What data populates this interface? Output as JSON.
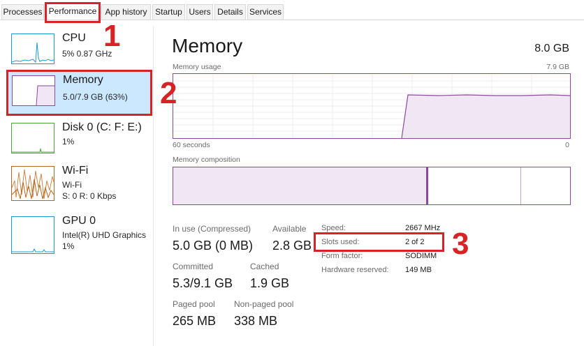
{
  "tabs": [
    {
      "label": "Processes"
    },
    {
      "label": "Performance"
    },
    {
      "label": "App history"
    },
    {
      "label": "Startup"
    },
    {
      "label": "Users"
    },
    {
      "label": "Details"
    },
    {
      "label": "Services"
    }
  ],
  "sidebar": {
    "items": [
      {
        "title": "CPU",
        "subtitle": "5%  0.87 GHz",
        "subtitle2": ""
      },
      {
        "title": "Memory",
        "subtitle": "5.0/7.9 GB (63%)",
        "subtitle2": ""
      },
      {
        "title": "Disk 0 (C: F: E:)",
        "subtitle": "1%",
        "subtitle2": ""
      },
      {
        "title": "Wi-Fi",
        "subtitle": "Wi-Fi",
        "subtitle2": "S: 0  R: 0 Kbps"
      },
      {
        "title": "GPU 0",
        "subtitle": "Intel(R) UHD Graphics",
        "subtitle2": "1%"
      }
    ]
  },
  "main": {
    "title": "Memory",
    "total": "8.0 GB",
    "usage_label": "Memory usage",
    "usage_max": "7.9 GB",
    "time_left": "60 seconds",
    "time_right": "0",
    "composition_label": "Memory composition",
    "stats": {
      "in_use_label": "In use (Compressed)",
      "in_use_value": "5.0 GB (0 MB)",
      "available_label": "Available",
      "available_value": "2.8 GB",
      "committed_label": "Committed",
      "committed_value": "5.3/9.1 GB",
      "cached_label": "Cached",
      "cached_value": "1.9 GB",
      "paged_label": "Paged pool",
      "paged_value": "265 MB",
      "nonpaged_label": "Non-paged pool",
      "nonpaged_value": "338 MB"
    },
    "specs": [
      {
        "label": "Speed:",
        "value": "2667 MHz"
      },
      {
        "label": "Slots used:",
        "value": "2 of 2"
      },
      {
        "label": "Form factor:",
        "value": "SODIMM"
      },
      {
        "label": "Hardware reserved:",
        "value": "149 MB"
      }
    ]
  },
  "annotations": {
    "n1": "1",
    "n2": "2",
    "n3": "3"
  },
  "colors": {
    "memory_accent": "#8b4a9a",
    "cpu_accent": "#1a9bcf",
    "disk_accent": "#4aa83a",
    "wifi_accent": "#b5651d",
    "gpu_accent": "#1a9bcf",
    "annotation_red": "#d72326",
    "selected_bg": "#cce8ff"
  }
}
